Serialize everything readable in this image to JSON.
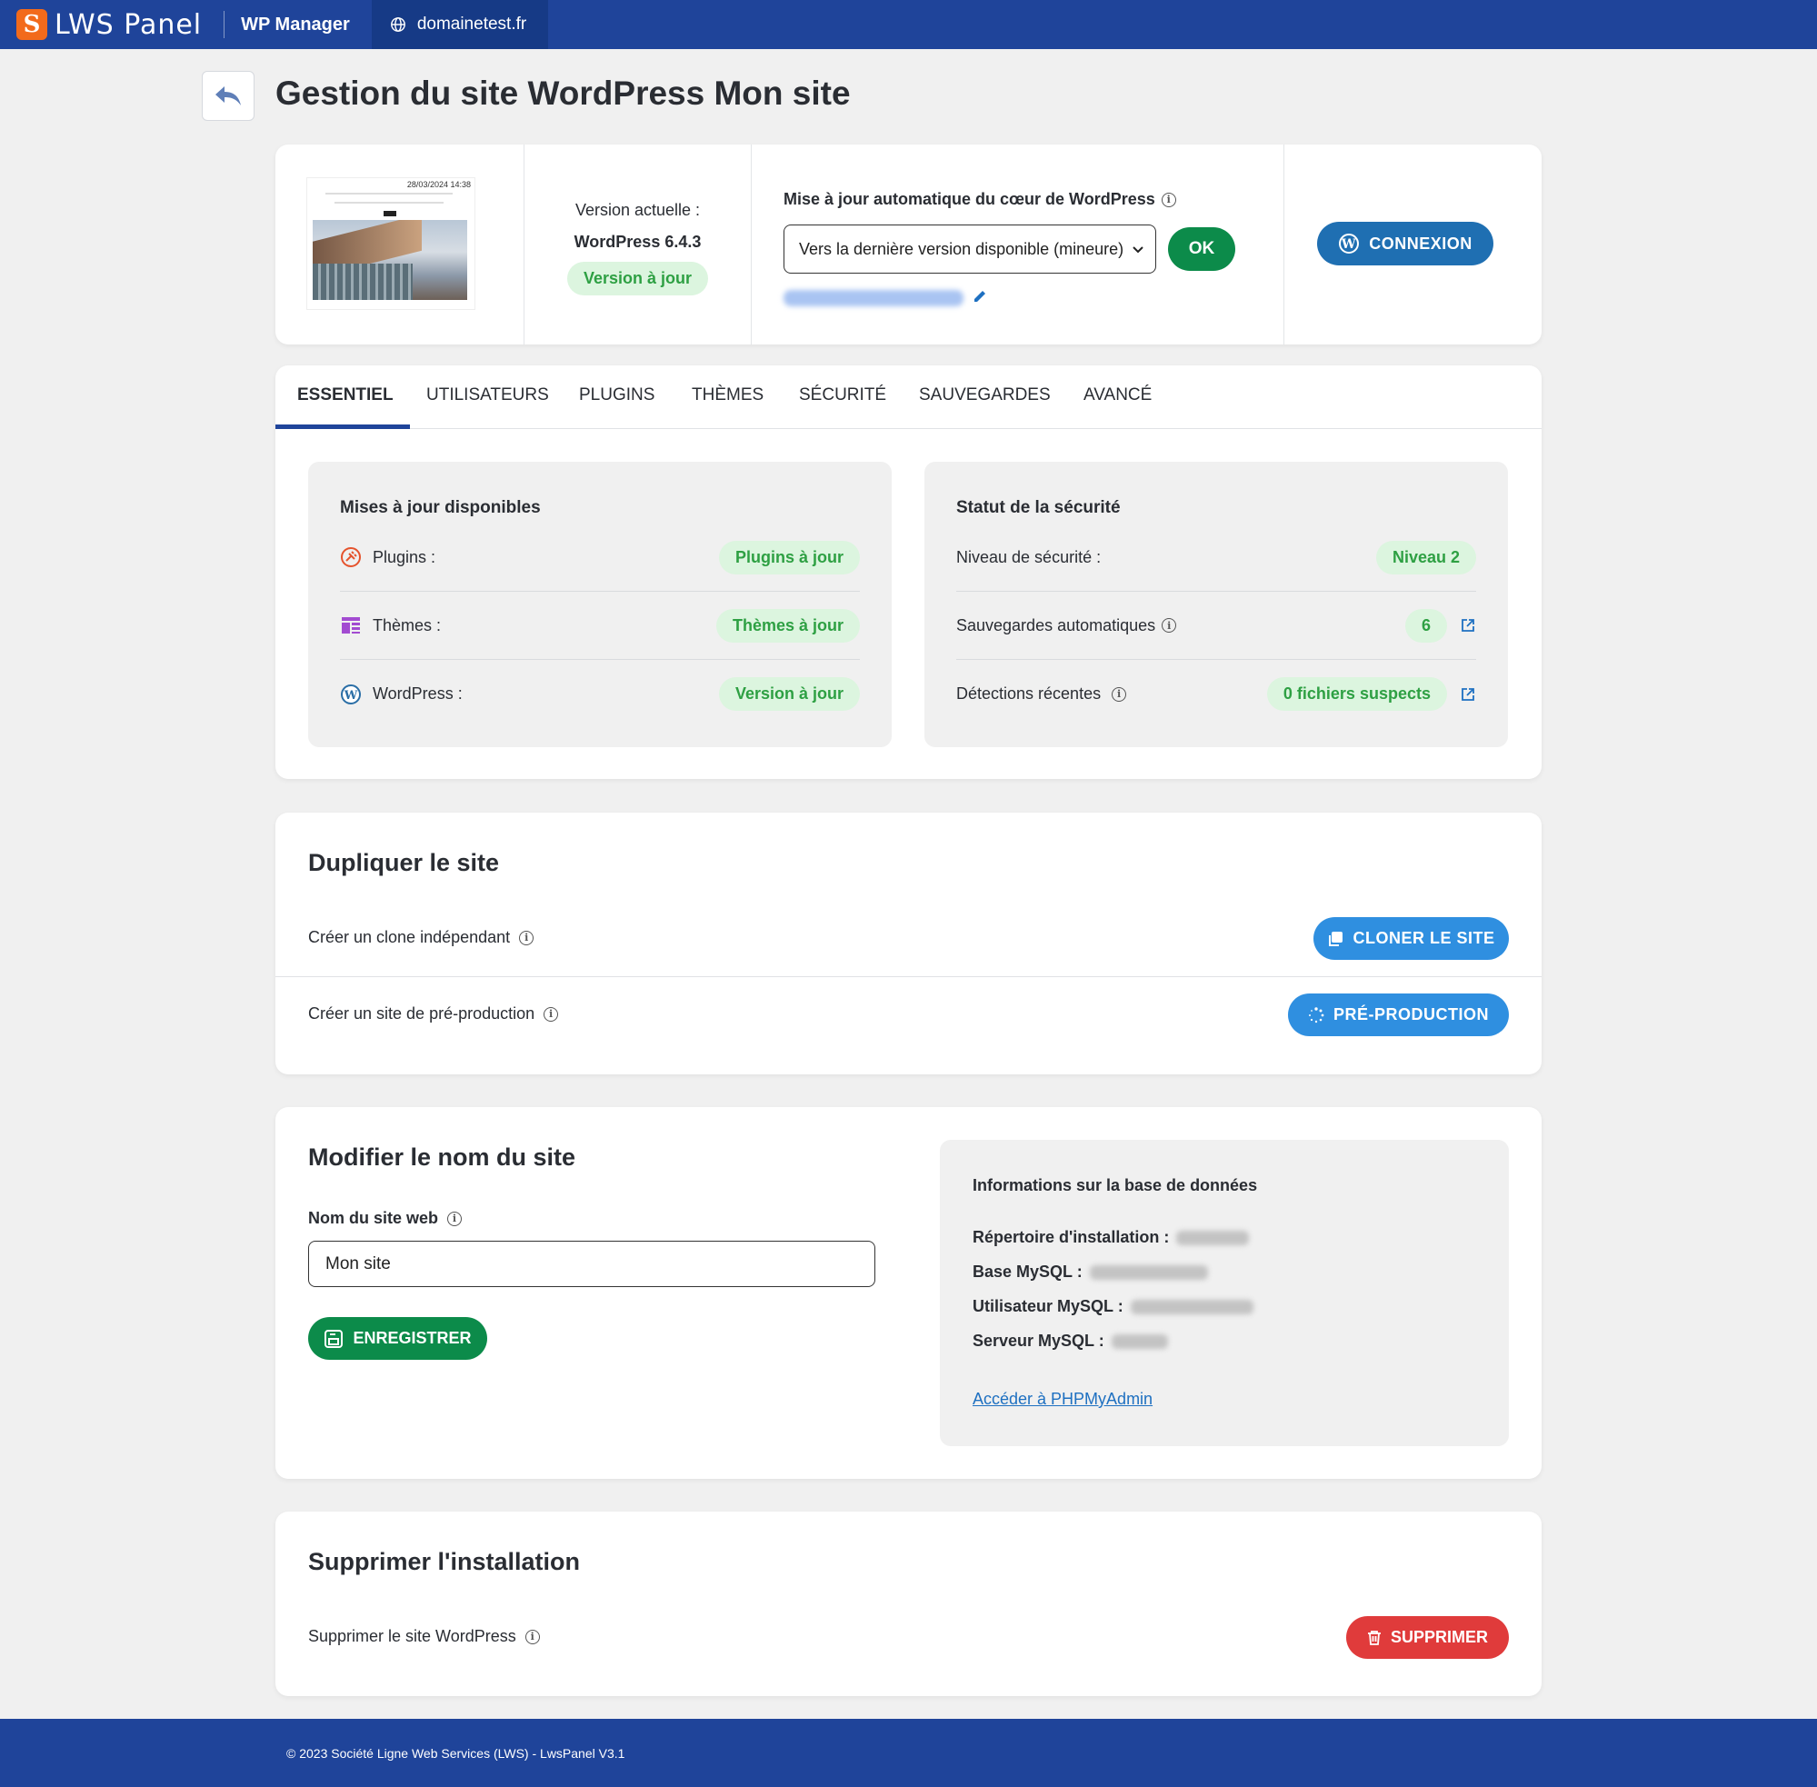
{
  "topbar": {
    "logo_mark": "S",
    "logo_text": "LWS Panel",
    "app_name": "WP Manager",
    "domain": "domainetest.fr"
  },
  "header": {
    "title": "Gestion du site WordPress Mon site"
  },
  "info": {
    "thumb_date": "28/03/2024 14:38",
    "version_label": "Version actuelle :",
    "version_value": "WordPress 6.4.3",
    "version_badge": "Version à jour",
    "auto_update_label": "Mise à jour automatique du cœur de WordPress",
    "auto_update_value": "Vers la dernière version disponible (mineure)",
    "ok_label": "OK",
    "connexion_label": "CONNEXION"
  },
  "tabs": [
    {
      "label": "ESSENTIEL",
      "active": true
    },
    {
      "label": "UTILISATEURS",
      "active": false
    },
    {
      "label": "PLUGINS",
      "active": false
    },
    {
      "label": "THÈMES",
      "active": false
    },
    {
      "label": "SÉCURITÉ",
      "active": false
    },
    {
      "label": "SAUVEGARDES",
      "active": false
    },
    {
      "label": "AVANCÉ",
      "active": false
    }
  ],
  "updates": {
    "title": "Mises à jour disponibles",
    "rows": [
      {
        "label": "Plugins :",
        "badge": "Plugins à jour",
        "icon": "plugin-icon"
      },
      {
        "label": "Thèmes :",
        "badge": "Thèmes à jour",
        "icon": "theme-icon"
      },
      {
        "label": "WordPress :",
        "badge": "Version à jour",
        "icon": "wordpress-icon"
      }
    ]
  },
  "security": {
    "title": "Statut de la sécurité",
    "rows": [
      {
        "label": "Niveau de sécurité :",
        "badge": "Niveau 2"
      },
      {
        "label": "Sauvegardes automatiques",
        "badge": "6"
      },
      {
        "label": "Détections récentes",
        "badge": "0 fichiers suspects"
      }
    ]
  },
  "duplicate": {
    "title": "Dupliquer le site",
    "clone_label": "Créer un clone indépendant",
    "clone_button": "CLONER LE SITE",
    "preprod_label": "Créer un site de pré-production",
    "preprod_button": "PRÉ-PRODUCTION"
  },
  "rename": {
    "title": "Modifier le nom du site",
    "field_label": "Nom du site web",
    "field_value": "Mon site",
    "save_button": "ENREGISTRER"
  },
  "database": {
    "title": "Informations sur la base de données",
    "install_dir_label": "Répertoire d'installation :",
    "mysql_base_label": "Base MySQL :",
    "mysql_user_label": "Utilisateur MySQL :",
    "mysql_server_label": "Serveur MySQL :",
    "phpmyadmin_link": "Accéder à PHPMyAdmin"
  },
  "delete": {
    "title": "Supprimer l'installation",
    "label": "Supprimer le site WordPress",
    "button": "SUPPRIMER"
  },
  "footer": {
    "text": "© 2023 Société Ligne Web Services (LWS) - LwsPanel V3.1"
  },
  "colors": {
    "topbar": "#1f449a",
    "green": "#0c8b4a",
    "badge_green_bg": "#dcf5df",
    "badge_green_text": "#2ea043",
    "blue_button": "#2f8fe0",
    "connexion_button": "#1f6fb2",
    "red_button": "#e03b3b",
    "link": "#1e70c1"
  }
}
